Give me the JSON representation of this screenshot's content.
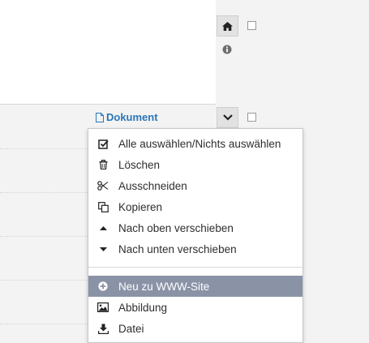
{
  "document_label": "Dokument",
  "menu": {
    "group1": [
      {
        "label": "Alle auswählen/Nichts auswählen",
        "icon": "checkbox-check-icon"
      },
      {
        "label": "Löschen",
        "icon": "trash-icon"
      },
      {
        "label": "Ausschneiden",
        "icon": "scissors-icon"
      },
      {
        "label": "Kopieren",
        "icon": "copy-icon"
      },
      {
        "label": "Nach oben verschieben",
        "icon": "caret-up-icon"
      },
      {
        "label": "Nach unten verschieben",
        "icon": "caret-down-icon"
      }
    ],
    "group2": [
      {
        "label": "Neu zu WWW-Site",
        "icon": "plus-circle-icon",
        "active": true
      },
      {
        "label": "Abbildung",
        "icon": "image-icon"
      },
      {
        "label": "Datei",
        "icon": "download-icon"
      }
    ]
  },
  "colors": {
    "link": "#2b76b6",
    "highlight": "#8a93a6",
    "background": "#f3f3f3"
  }
}
